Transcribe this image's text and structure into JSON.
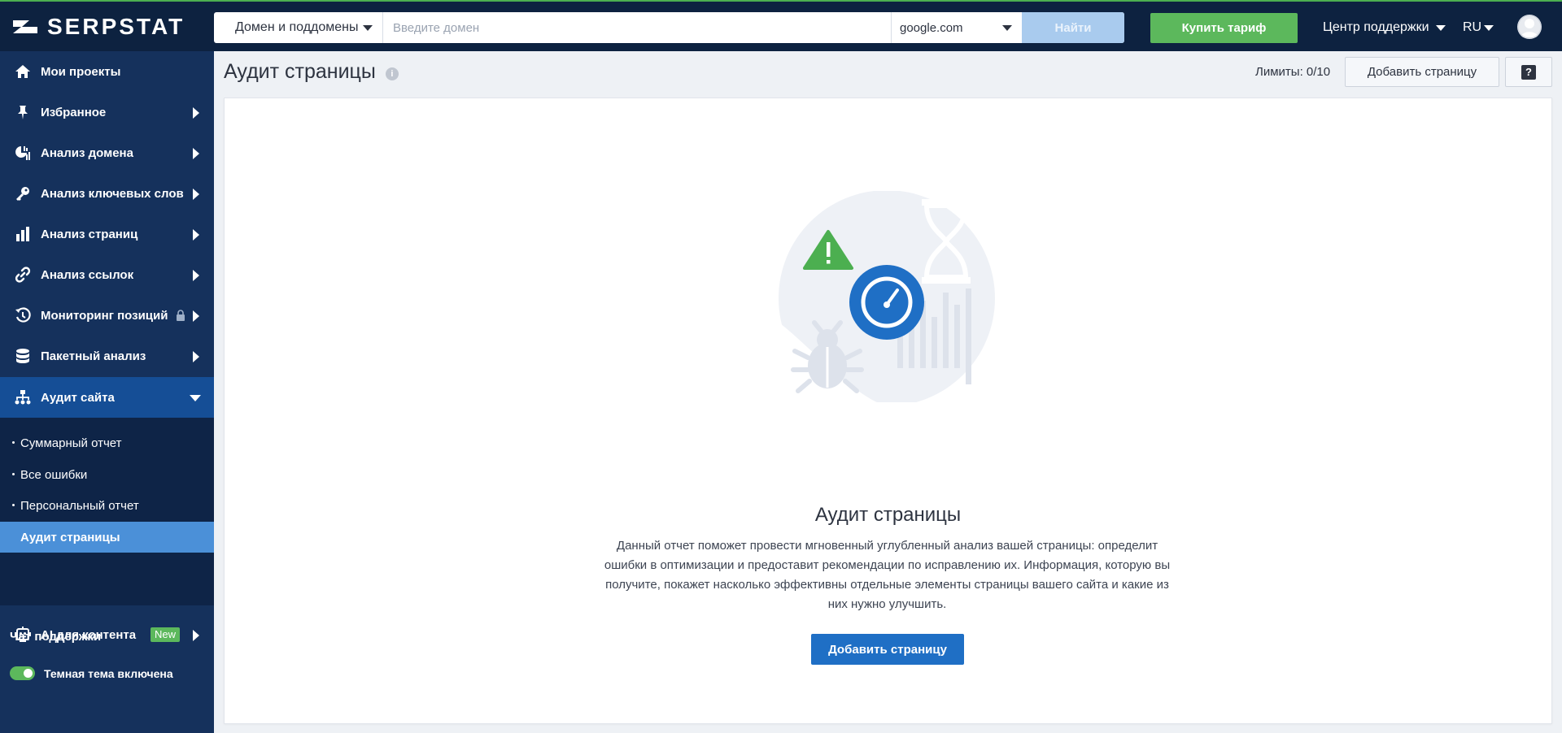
{
  "brand": {
    "name": "SERPSTAT"
  },
  "search": {
    "scope_value": "Домен и поддомены",
    "domain_placeholder": "Введите домен",
    "domain_value": "",
    "engine_value": "google.com",
    "find_label": "Найти"
  },
  "header": {
    "buy_label": "Купить тариф",
    "support_label": "Центр поддержки",
    "lang_label": "RU"
  },
  "sidebar": {
    "items": [
      {
        "label": "Мои проекты"
      },
      {
        "label": "Избранное"
      },
      {
        "label": "Анализ домена"
      },
      {
        "label": "Анализ ключевых слов"
      },
      {
        "label": "Анализ страниц"
      },
      {
        "label": "Анализ ссылок"
      },
      {
        "label": "Мониторинг позиций"
      },
      {
        "label": "Пакетный анализ"
      },
      {
        "label": "Аудит сайта"
      },
      {
        "label": "AI для контента",
        "badge": "New"
      }
    ],
    "submenu": [
      {
        "label": "Суммарный отчет"
      },
      {
        "label": "Все ошибки"
      },
      {
        "label": "Персональный отчет"
      },
      {
        "label": "Аудит страницы"
      }
    ],
    "chat_support": "Чат поддержки",
    "dark_theme_label": "Темная тема включена"
  },
  "page": {
    "title": "Аудит страницы",
    "info_glyph": "i",
    "limits": "Лимиты: 0/10",
    "add_page_label": "Добавить страницу",
    "help_glyph": "?"
  },
  "empty_state": {
    "title": "Аудит страницы",
    "description": "Данный отчет поможет провести мгновенный углубленный анализ вашей страницы: определит ошибки в оптимизации и предоставит рекомендации по исправлению их. Информация, которую вы получите, покажет насколько эффективны отдельные элементы страницы вашего сайта и какие из них нужно улучшить.",
    "button_label": "Добавить страницу"
  },
  "colors": {
    "topbar": "#0d2240",
    "sidebar": "#15315c",
    "active_item": "#154e96",
    "active_subitem": "#4b90d8",
    "accent_green": "#5cb85c",
    "primary_blue": "#1f6fc5"
  },
  "icons": {
    "logo": "serpstat-logo-icon",
    "nav": [
      "home-icon",
      "pin-icon",
      "domain-analysis-icon",
      "key-icon",
      "bar-chart-icon",
      "link-icon",
      "history-icon",
      "database-icon",
      "sitemap-icon",
      "robot-icon"
    ],
    "lock": "lock-icon",
    "avatar": "user-avatar-icon",
    "illustration": [
      "warning-triangle-icon",
      "speedometer-icon",
      "bug-icon",
      "hourglass-icon",
      "bars-icon"
    ]
  }
}
